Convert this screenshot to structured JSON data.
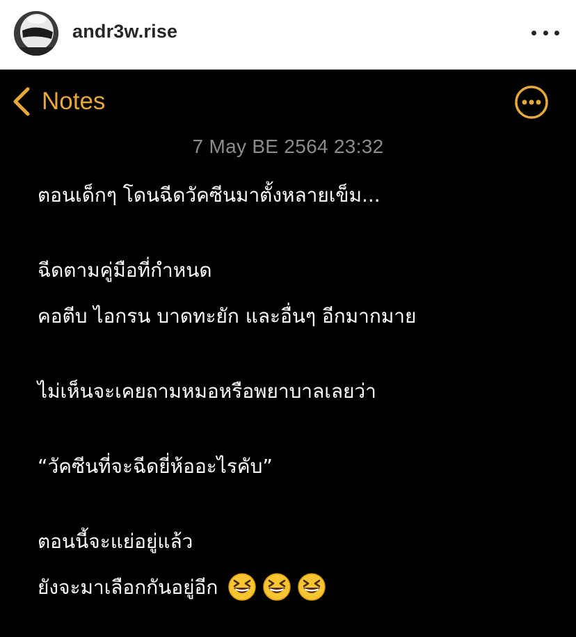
{
  "post": {
    "username": "andr3w.rise",
    "avatar_icon": "helmet-avatar-icon",
    "more_icon": "more-horizontal-icon"
  },
  "note_app": {
    "back_label": "Notes",
    "back_icon": "chevron-left-icon",
    "action_icon": "more-circle-icon",
    "accent_color": "#E5A93B",
    "background_color": "#000000",
    "date": "7 May BE 2564 23:32",
    "lines": [
      "ตอนเด็กๆ โดนฉีดวัคซีนมาตั้งหลายเข็ม...",
      "ฉีดตามคู่มือที่กำหนด",
      "คอตีบ ไอกรน บาดทะยัก และอื่นๆ อีกมากมาย",
      "ไม่เห็นจะเคยถามหมอหรือพยาบาลเลยว่า",
      "“วัคซีนที่จะฉีดยี่ห้ออะไรคับ”",
      "ตอนนี้จะแย่อยู่แล้ว",
      "ยังจะมาเลือกกันอยู่อีก"
    ],
    "trailing_emoji": [
      "grinning-squinting-face-emoji",
      "grinning-squinting-face-emoji",
      "grinning-squinting-face-emoji"
    ]
  }
}
